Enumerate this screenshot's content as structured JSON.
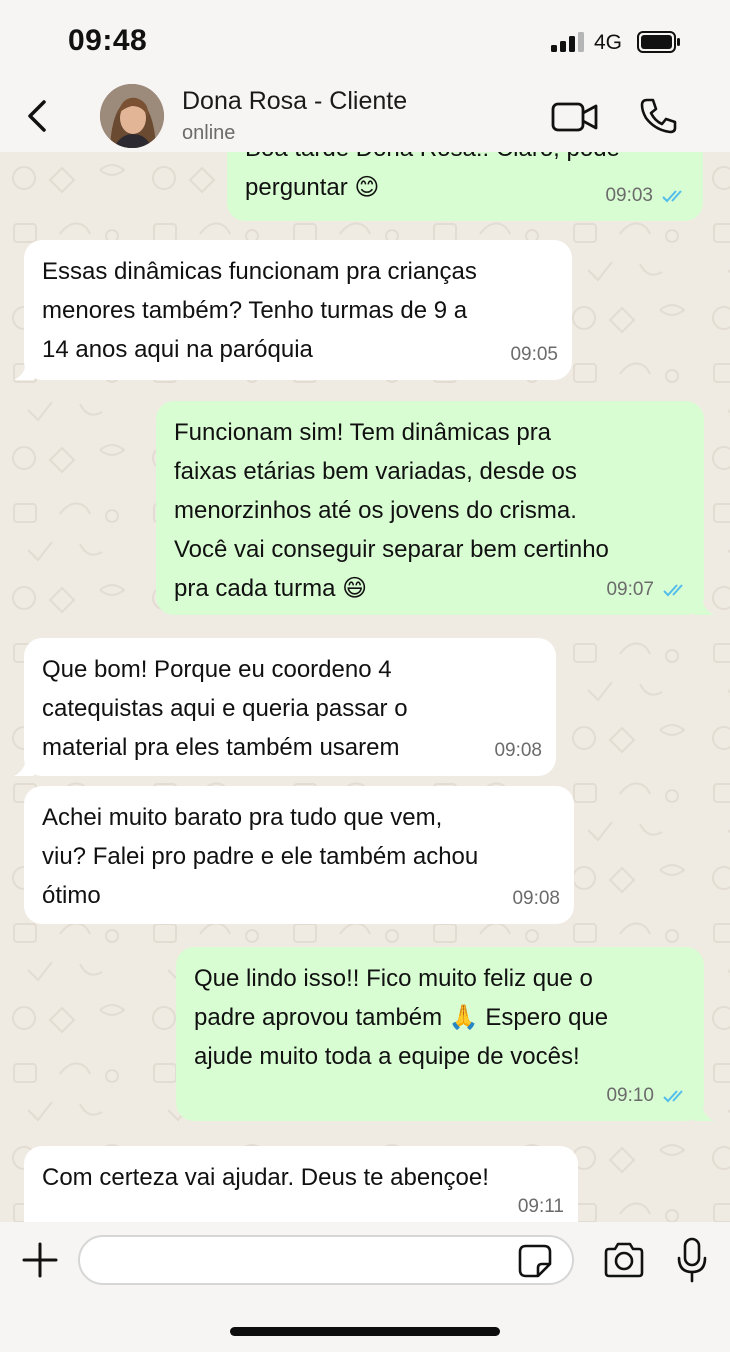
{
  "status_bar": {
    "time": "09:48",
    "network": "4G"
  },
  "header": {
    "contact_name": "Dona Rosa - Cliente",
    "contact_status": "online"
  },
  "messages": [
    {
      "direction": "out",
      "text": "Boa tarde Dona Rosa!! Claro, pode\nperguntar 😊",
      "time": "09:03",
      "status": "read"
    },
    {
      "direction": "in",
      "text": "Essas dinâmicas funcionam pra crianças\nmenores também? Tenho turmas de 9 a\n14 anos aqui na paróquia",
      "time": "09:05"
    },
    {
      "direction": "out",
      "text": "Funcionam sim! Tem dinâmicas pra\nfaixas etárias bem variadas, desde os\nmenorzinhos até os jovens do crisma.\nVocê vai conseguir separar bem certinho\npra cada turma 😄",
      "time": "09:07",
      "status": "read"
    },
    {
      "direction": "in",
      "text": "Que bom! Porque eu coordeno 4\ncatequistas aqui e queria passar o\nmaterial pra eles também usarem",
      "time": "09:08"
    },
    {
      "direction": "in",
      "text": "Achei muito barato pra tudo que vem,\nviu? Falei pro padre e ele também achou\nótimo",
      "time": "09:08"
    },
    {
      "direction": "out",
      "text": "Que lindo isso!! Fico muito feliz que o\npadre aprovou também 🙏 Espero que\najude muito toda a equipe de vocês!",
      "time": "09:10",
      "status": "read"
    },
    {
      "direction": "in",
      "text": "Com certeza vai ajudar. Deus te abençoe!",
      "time": "09:11"
    }
  ],
  "input": {
    "placeholder": "",
    "value": ""
  },
  "icons": {
    "back": "chevron-left-icon",
    "video": "video-camera-icon",
    "call": "phone-icon",
    "attach": "plus-icon",
    "sticker": "sticker-icon",
    "camera": "camera-icon",
    "mic": "microphone-icon",
    "read_receipt": "double-check-icon"
  },
  "colors": {
    "incoming_bubble": "#ffffff",
    "outgoing_bubble": "#d9fdd3",
    "chat_background": "#efeae2",
    "read_ticks": "#53bdeb",
    "chrome": "#f6f5f3"
  }
}
